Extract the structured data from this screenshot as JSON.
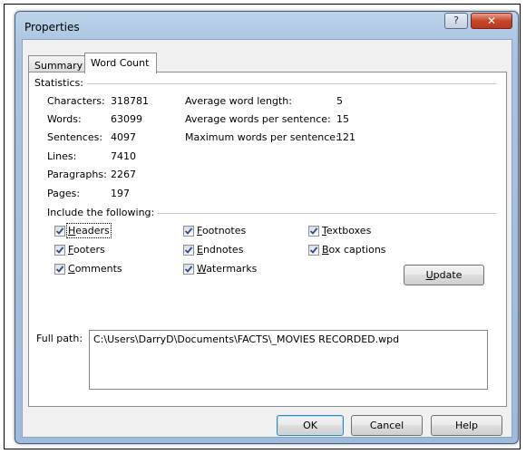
{
  "window": {
    "title": "Properties",
    "help_glyph": "?",
    "close_glyph": "✕"
  },
  "tabs": [
    {
      "label": "Summary"
    },
    {
      "label": "Word Count"
    }
  ],
  "statistics": {
    "label": "Statistics:",
    "left": [
      {
        "label": "Characters:",
        "value": "318781"
      },
      {
        "label": "Words:",
        "value": "63099"
      },
      {
        "label": "Sentences:",
        "value": "4097"
      },
      {
        "label": "Lines:",
        "value": "7410"
      },
      {
        "label": "Paragraphs:",
        "value": "2267"
      },
      {
        "label": "Pages:",
        "value": "197"
      }
    ],
    "right": [
      {
        "label": "Average word length:",
        "value": "5"
      },
      {
        "label": "Average words per sentence:",
        "value": "15"
      },
      {
        "label": "Maximum words per sentence:",
        "value": "121"
      }
    ]
  },
  "include": {
    "label": "Include the following:",
    "options": [
      {
        "first": "H",
        "rest": "eaders",
        "checked": true
      },
      {
        "first": "F",
        "rest": "ooters",
        "checked": true
      },
      {
        "first": "C",
        "rest": "omments",
        "checked": true
      },
      {
        "first": "F",
        "rest": "ootnotes",
        "checked": true
      },
      {
        "first": "E",
        "rest": "ndnotes",
        "checked": true
      },
      {
        "first": "W",
        "rest": "atermarks",
        "checked": true
      },
      {
        "first": "T",
        "rest": "extboxes",
        "checked": true
      },
      {
        "first": "B",
        "rest": "ox captions",
        "checked": true
      }
    ]
  },
  "update_button": {
    "first": "U",
    "rest": "pdate"
  },
  "full_path": {
    "label": "Full path:",
    "value": "C:\\Users\\DarryD\\Documents\\FACTS\\_MOVIES RECORDED.wpd"
  },
  "footer": {
    "ok": "OK",
    "cancel": "Cancel",
    "help": "Help"
  }
}
